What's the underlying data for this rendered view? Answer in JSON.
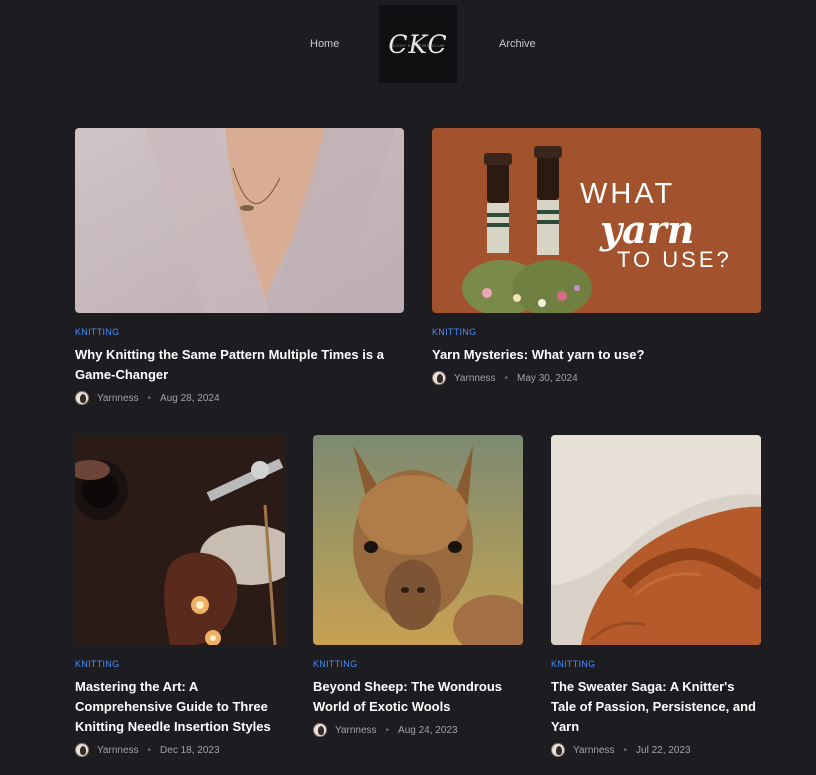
{
  "nav": {
    "home": "Home",
    "archive": "Archive"
  },
  "logo": {
    "text": "CKC",
    "sub": "COZY KNITTING CLUB"
  },
  "posts": [
    {
      "category": "KNITTING",
      "title": "Why Knitting the Same Pattern Multiple Times is a Game-Changer",
      "author": "Yarnness",
      "date": "Aug 28, 2024"
    },
    {
      "category": "KNITTING",
      "title": "Yarn Mysteries: What yarn to use?",
      "author": "Yarnness",
      "date": "May 30, 2024",
      "image_text": [
        "WHAT",
        "yarn",
        "TO USE?"
      ]
    },
    {
      "category": "KNITTING",
      "title": "Mastering the Art: A Comprehensive Guide to Three Knitting Needle Insertion Styles",
      "author": "Yarnness",
      "date": "Dec 18, 2023"
    },
    {
      "category": "KNITTING",
      "title": "Beyond Sheep: The Wondrous World of Exotic Wools",
      "author": "Yarnness",
      "date": "Aug 24, 2023"
    },
    {
      "category": "KNITTING",
      "title": "The Sweater Saga: A Knitter's Tale of Passion, Persistence, and Yarn",
      "author": "Yarnness",
      "date": "Jul 22, 2023"
    }
  ]
}
